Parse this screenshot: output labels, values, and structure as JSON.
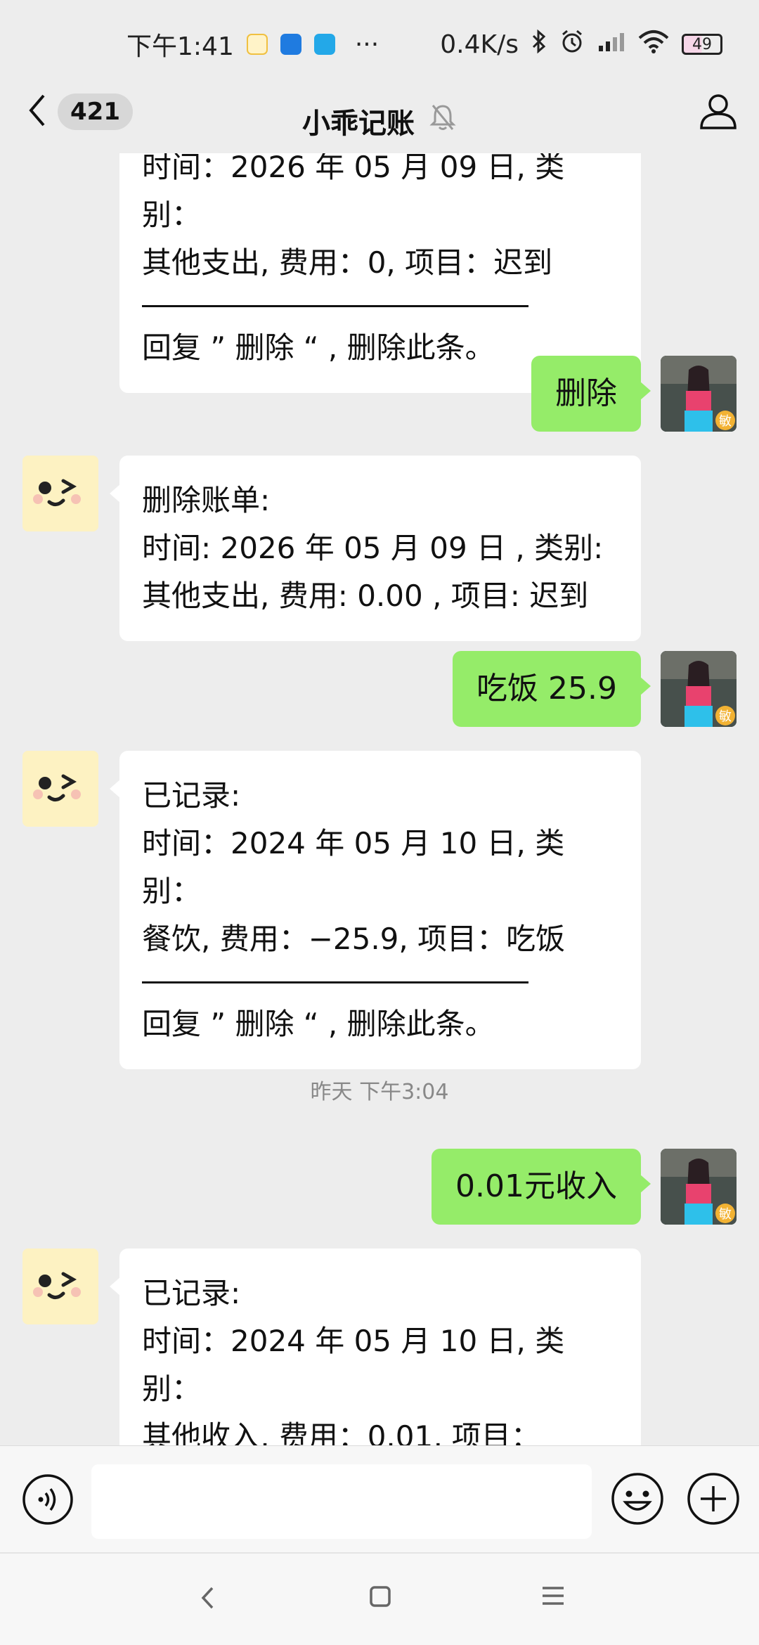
{
  "status_bar": {
    "time": "下午1:41",
    "more": "···",
    "net_speed": "0.4K/s",
    "battery": "49",
    "icons": [
      "app-icon-yellow",
      "app-icon-blue",
      "app-icon-clapper",
      "bluetooth-icon",
      "alarm-icon",
      "signal-icon",
      "wifi-icon",
      "battery-icon"
    ]
  },
  "nav": {
    "unread_count": "421",
    "title": "小乖记账",
    "icons": [
      "back-chevron-icon",
      "mute-bell-icon",
      "profile-icon"
    ]
  },
  "messages": {
    "m1": {
      "partial_line": "时间：2026 年 05 月 09 日, 类别：",
      "line2": "其他支出, 费用：0, 项目：迟到",
      "reply_hint": "回复 ” 删除 “ , 删除此条。"
    },
    "m2": {
      "text": "删除"
    },
    "m3": {
      "header": "删除账单:",
      "line1": "时间: 2026 年 05 月 09 日 , 类别:",
      "line2": "其他支出, 费用: 0.00 , 项目: 迟到"
    },
    "m4": {
      "text": "吃饭 25.9"
    },
    "m5": {
      "header": "已记录:",
      "line1": "时间：2024 年 05 月 10 日, 类别：",
      "line2": "餐饮, 费用：−25.9, 项目：吃饭",
      "reply_hint": "回复 ” 删除 “ , 删除此条。"
    },
    "timestamp": "昨天 下午3:04",
    "m6": {
      "text": "0.01元收入"
    },
    "m7": {
      "header": "已记录:",
      "line1": "时间：2024 年 05 月 10 日, 类别：",
      "line2": "其他收入, 费用：0.01, 项目："
    }
  },
  "user_badge": "敏",
  "input": {
    "placeholder": ""
  },
  "colors": {
    "green_bubble": "#95ec69",
    "background": "#ededed",
    "badge": "#f2b233"
  }
}
